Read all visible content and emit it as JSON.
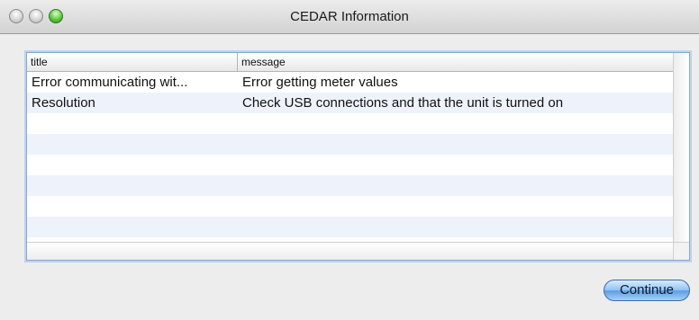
{
  "window": {
    "title": "CEDAR Information"
  },
  "table": {
    "columns": [
      "title",
      "message"
    ],
    "rows": [
      {
        "title": "Error communicating wit...",
        "message": "Error getting meter values"
      },
      {
        "title": "Resolution",
        "message": "Check USB connections and that the unit is turned on"
      }
    ]
  },
  "buttons": {
    "continue_label": "Continue"
  },
  "icons": {
    "close": "close-icon",
    "minimize": "minimize-icon",
    "zoom": "zoom-icon"
  },
  "colors": {
    "accent": "#5d9be0",
    "row_alt": "#eef3fb"
  }
}
